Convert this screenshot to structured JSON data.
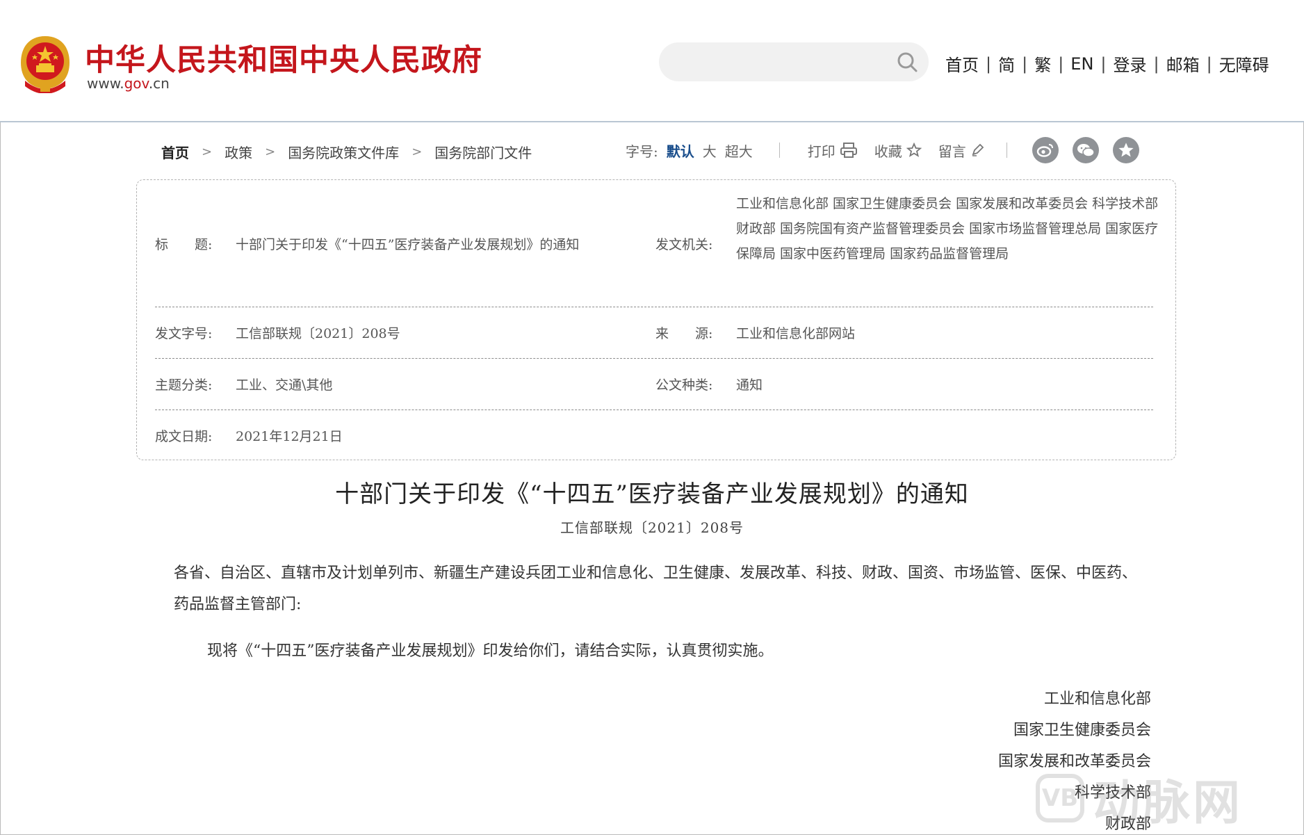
{
  "header": {
    "site_title": "中华人民共和国中央人民政府",
    "site_url_prefix": "www.",
    "site_url_brand": "gov",
    "site_url_suffix": ".cn",
    "search_placeholder": "",
    "nav": [
      "首页",
      "简",
      "繁",
      "EN",
      "登录",
      "邮箱",
      "无障碍"
    ],
    "brand_color": "#c4161c"
  },
  "breadcrumb": [
    "首页",
    "政策",
    "国务院政策文件库",
    "国务院部门文件"
  ],
  "toolbar": {
    "font_size_label": "字号:",
    "font_sizes": [
      "默认",
      "大",
      "超大"
    ],
    "print_label": "打印",
    "favorite_label": "收藏",
    "comment_label": "留言",
    "share_icons": [
      "weibo-icon",
      "wechat-icon",
      "favorite-star-icon"
    ]
  },
  "info": {
    "title_label": "标　　题:",
    "title_value": "十部门关于印发《“十四五”医疗装备产业发展规划》的通知",
    "issuer_label": "发文机关:",
    "issuer_value": "工业和信息化部 国家卫生健康委员会 国家发展和改革委员会 科学技术部 财政部 国务院国有资产监督管理委员会 国家市场监督管理总局 国家医疗保障局 国家中医药管理局 国家药品监督管理局",
    "docno_label": "发文字号:",
    "docno_value": "工信部联规〔2021〕208号",
    "source_label": "来　　源:",
    "source_value": "工业和信息化部网站",
    "category_label": "主题分类:",
    "category_value": "工业、交通\\其他",
    "doctype_label": "公文种类:",
    "doctype_value": "通知",
    "date_label": "成文日期:",
    "date_value": "2021年12月21日"
  },
  "article": {
    "title": "十部门关于印发《“十四五”医疗装备产业发展规划》的通知",
    "doc_number": "工信部联规〔2021〕208号",
    "recipients": "各省、自治区、直辖市及计划单列市、新疆生产建设兵团工业和信息化、卫生健康、发展改革、科技、财政、国资、市场监管、医保、中医药、药品监督主管部门:",
    "body": "现将《“十四五”医疗装备产业发展规划》印发给你们，请结合实际，认真贯彻实施。",
    "signatories": [
      "工业和信息化部",
      "国家卫生健康委员会",
      "国家发展和改革委员会",
      "科学技术部",
      "财政部"
    ]
  },
  "watermark": {
    "logo_glyph": "VB",
    "text": "动脉网"
  }
}
